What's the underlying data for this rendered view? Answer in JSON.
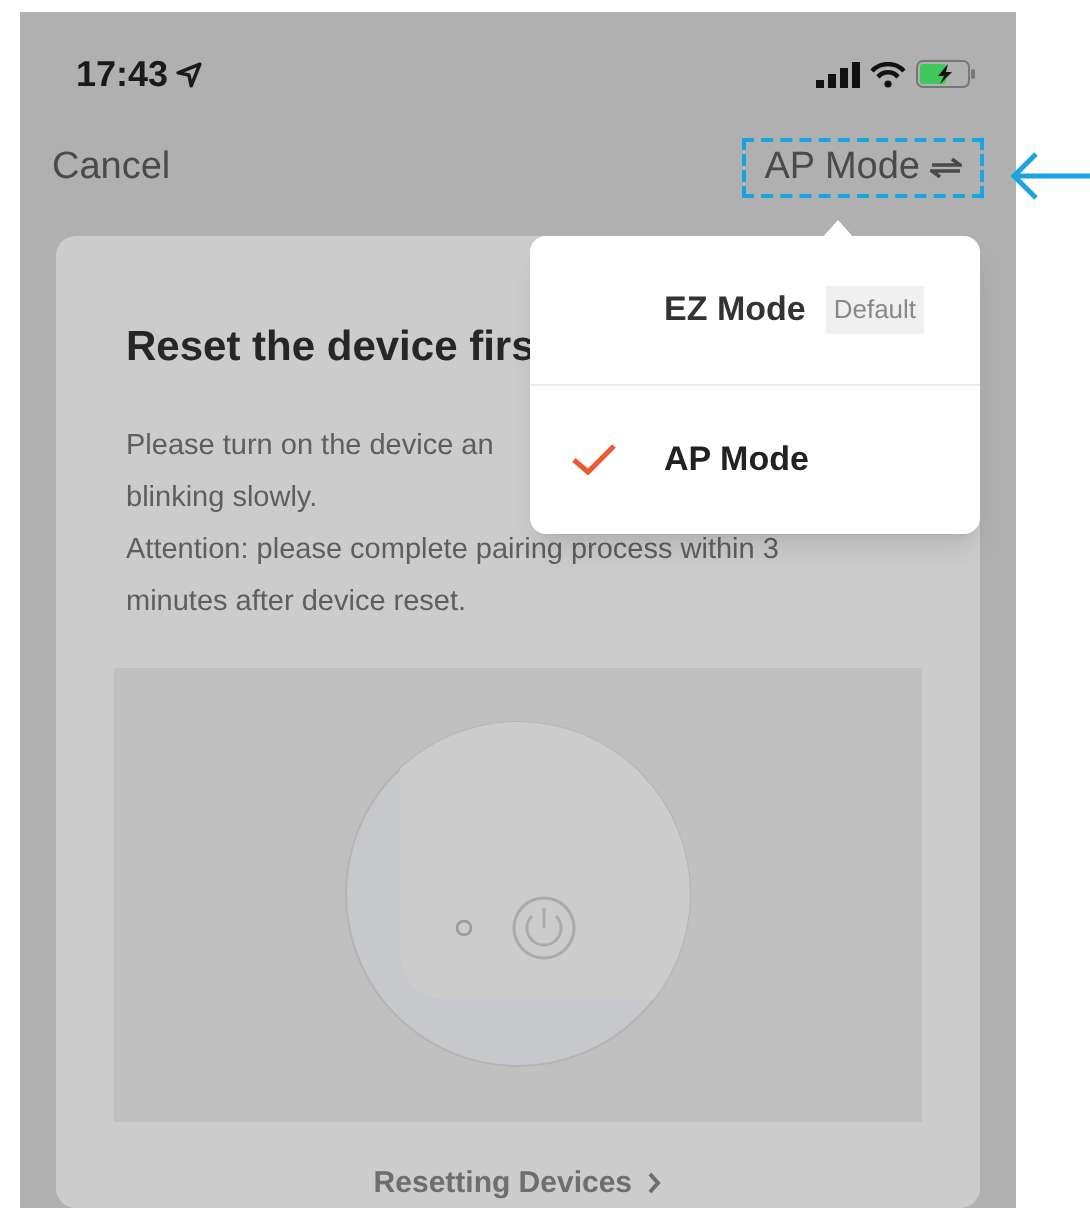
{
  "status_bar": {
    "time": "17:43"
  },
  "nav": {
    "cancel": "Cancel",
    "mode_button": "AP Mode",
    "highlighted": true
  },
  "card": {
    "title": "Reset the device firs",
    "lines": [
      "Please turn on the device an",
      "blinking slowly.",
      "Attention: please complete pairing process within 3",
      "minutes after device reset."
    ],
    "link": "Resetting Devices"
  },
  "menu": {
    "items": [
      {
        "label": "EZ Mode",
        "badge": "Default",
        "selected": false
      },
      {
        "label": "AP Mode",
        "selected": true
      }
    ]
  }
}
